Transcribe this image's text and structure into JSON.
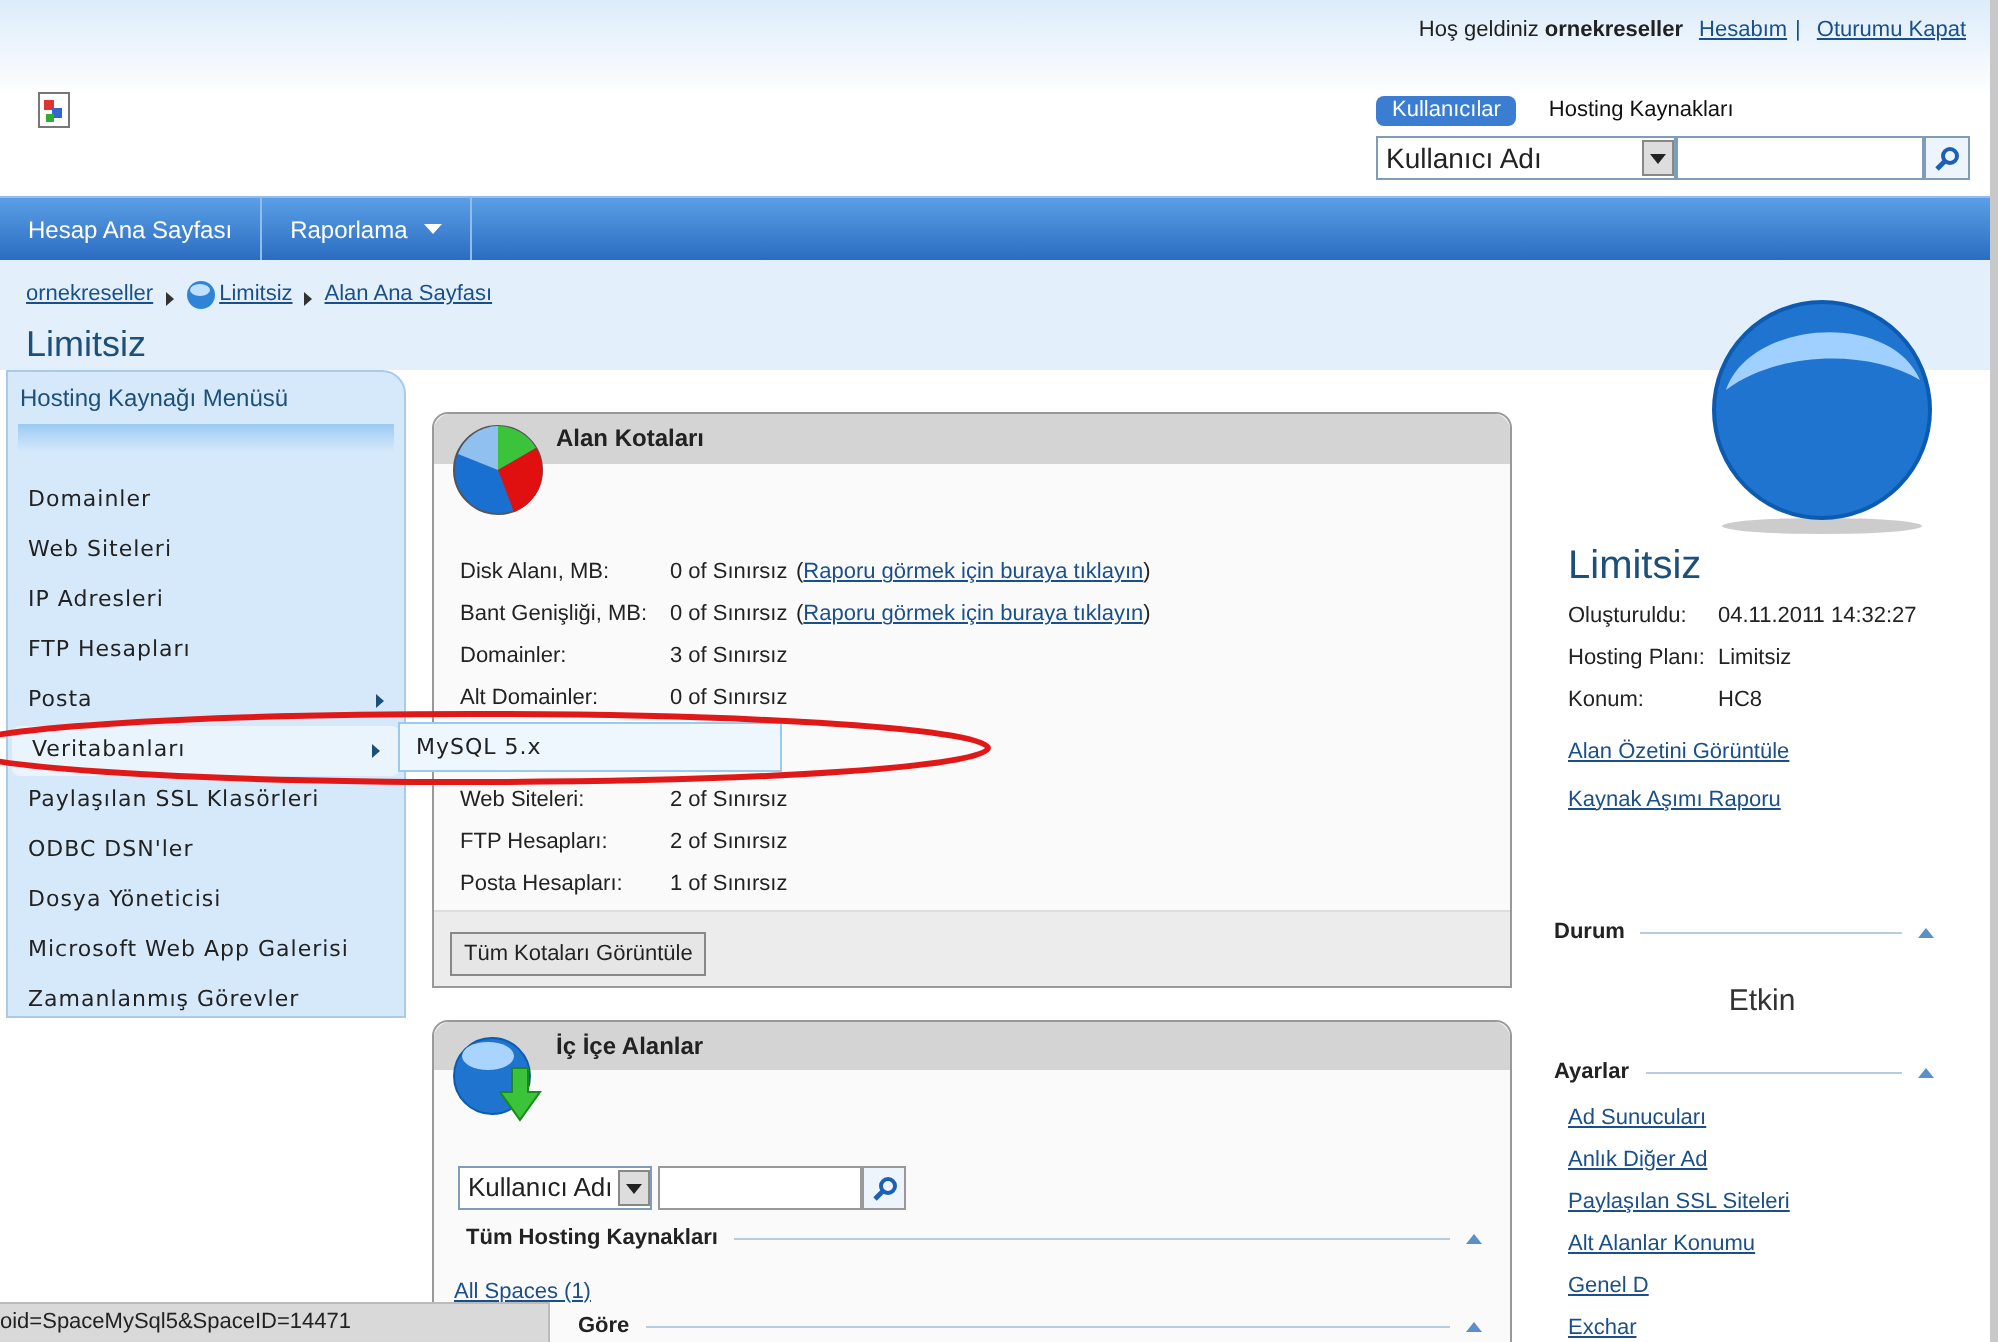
{
  "header": {
    "greeting": "Hoş geldiniz",
    "user": "ornekreseller",
    "links": [
      "Hesabım",
      "Oturumu Kapat"
    ],
    "separator": "|",
    "search_tabs": [
      {
        "label": "Kullanıcılar",
        "selected": true
      },
      {
        "label": "Hosting Kaynakları",
        "selected": false
      }
    ],
    "search_select": "Kullanıcı Adı"
  },
  "nav": [
    {
      "label": "Hesap Ana Sayfası",
      "dropdown": false
    },
    {
      "label": "Raporlama",
      "dropdown": true
    }
  ],
  "breadcrumb": [
    {
      "label": "ornekreseller",
      "kind": "plain"
    },
    {
      "label": "Limitsiz",
      "kind": "space"
    },
    {
      "label": "Alan Ana Sayfası",
      "kind": "plain"
    }
  ],
  "page_title": "Limitsiz",
  "sidebar": {
    "title": "Hosting Kaynağı Menüsü",
    "items": [
      {
        "label": "Domainler",
        "submenu": false,
        "selected": false
      },
      {
        "label": "Web Siteleri",
        "submenu": false,
        "selected": false
      },
      {
        "label": "IP Adresleri",
        "submenu": false,
        "selected": false
      },
      {
        "label": "FTP Hesapları",
        "submenu": false,
        "selected": false
      },
      {
        "label": "Posta",
        "submenu": true,
        "selected": false
      },
      {
        "label": "Veritabanları",
        "submenu": true,
        "selected": true
      },
      {
        "label": "Paylaşılan SSL Klasörleri",
        "submenu": false,
        "selected": false
      },
      {
        "label": "ODBC DSN'ler",
        "submenu": false,
        "selected": false
      },
      {
        "label": "Dosya Yöneticisi",
        "submenu": false,
        "selected": false
      },
      {
        "label": "Microsoft Web App Galerisi",
        "submenu": false,
        "selected": false
      },
      {
        "label": "Zamanlanmış Görevler",
        "submenu": false,
        "selected": false
      }
    ],
    "submenu": [
      "MySQL 5.x"
    ]
  },
  "quotas": {
    "title": "Alan Kotaları",
    "rows": [
      {
        "label": "Disk Alanı, MB:",
        "value": "0 of Sınırsız",
        "link_open": "(",
        "link": "Raporu görmek için buraya tıklayın",
        "link_close": ")"
      },
      {
        "label": "Bant Genişliği, MB:",
        "value": "0 of Sınırsız",
        "link_open": "(",
        "link": "Raporu görmek için buraya tıklayın",
        "link_close": ")"
      },
      {
        "label": "Domainler:",
        "value": "3 of Sınırsız"
      },
      {
        "label": "Alt Domainler:",
        "value": "0 of Sınırsız"
      },
      {
        "label": "Web Siteleri:",
        "value": "2 of Sınırsız",
        "hidden_above": true
      },
      {
        "label": "FTP Hesapları:",
        "value": "2 of Sınırsız"
      },
      {
        "label": "Posta Hesapları:",
        "value": "1 of Sınırsız"
      }
    ],
    "button": "Tüm Kotaları Görüntüle"
  },
  "nested": {
    "title": "İç İçe Alanlar",
    "search_select": "Kullanıcı Adı",
    "section": "Tüm Hosting Kaynakları",
    "link": "All Spaces (1)",
    "section_2": "Göre"
  },
  "info": {
    "title": "Limitsiz",
    "fields": [
      {
        "label": "Oluşturuldu:",
        "value": "04.11.2011 14:32:27"
      },
      {
        "label": "Hosting Planı:",
        "value": "Limitsiz"
      },
      {
        "label": "Konum:",
        "value": "HC8"
      }
    ],
    "links": [
      "Alan Özetini Görüntüle",
      "Kaynak Aşımı Raporu"
    ],
    "status_title": "Durum",
    "status": "Etkin",
    "settings_title": "Ayarlar",
    "settings_links": [
      "Ad Sunucuları",
      "Anlık Diğer Ad",
      "Paylaşılan SSL Siteleri",
      "Alt Alanlar Konumu",
      "Genel D",
      "Exchar"
    ]
  },
  "status_bar": "oid=SpaceMySql5&SpaceID=14471"
}
